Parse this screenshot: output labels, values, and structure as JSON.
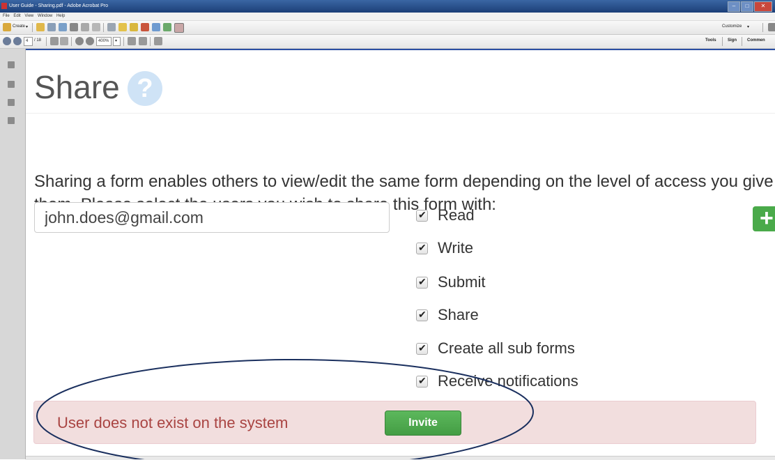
{
  "window": {
    "title": "User Guide - Sharing.pdf - Adobe Acrobat Pro"
  },
  "menu": [
    "File",
    "Edit",
    "View",
    "Window",
    "Help"
  ],
  "toolbar": {
    "create_label": "Create",
    "customize_label": "Customize",
    "page_current": "4",
    "page_total": "/ 18",
    "zoom": "400%",
    "tools_label": "Tools",
    "sign_label": "Sign",
    "comment_label": "Commen"
  },
  "share": {
    "title": "Share",
    "help_symbol": "?",
    "description": "Sharing a form enables others to view/edit the same form depending on the level of access you give them. Please select the users you wish to share this form with:",
    "email_value": "john.does@gmail.com",
    "permissions": [
      {
        "label": "Read",
        "checked": true
      },
      {
        "label": "Write",
        "checked": true
      },
      {
        "label": "Submit",
        "checked": true
      },
      {
        "label": "Share",
        "checked": true
      },
      {
        "label": "Create all sub forms",
        "checked": true
      },
      {
        "label": "Receive notifications",
        "checked": true
      }
    ],
    "add_symbol": "+",
    "alert_message": "User does not exist on the system",
    "invite_label": "Invite"
  },
  "colors": {
    "success_green": "#5cb85c",
    "alert_bg": "#f2dede",
    "alert_text": "#a94442",
    "annotation": "#1a2f5e"
  }
}
